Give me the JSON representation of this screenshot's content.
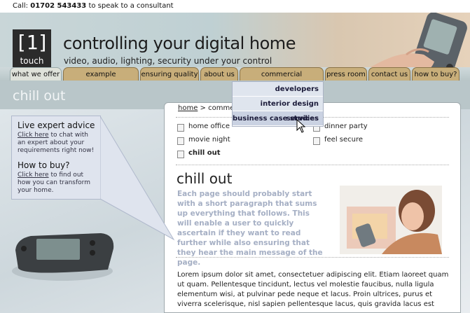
{
  "callbar": {
    "prefix": "Call:",
    "phone": "01702 543433",
    "suffix": "to speak to a consultant"
  },
  "header": {
    "logo_num": "[1]",
    "logo_word": "touch",
    "tagline": "controlling your digital home",
    "subline": "video, audio, lighting, security under your control"
  },
  "tabs": [
    {
      "label": "what we offer"
    },
    {
      "label": "example installations"
    },
    {
      "label": "ensuring quality"
    },
    {
      "label": "about us"
    },
    {
      "label": "commercial partnership"
    },
    {
      "label": "press room"
    },
    {
      "label": "contact us"
    },
    {
      "label": "how to buy?"
    }
  ],
  "dropdown": [
    {
      "label": "developers"
    },
    {
      "label": "interior design services"
    },
    {
      "label": "business case studies"
    }
  ],
  "page_heading": "chill out",
  "callout": {
    "title1": "Live expert advice",
    "link1": "Click here",
    "text1": "to chat with an expert about your requirements right now!",
    "title2": "How to buy?",
    "link2": "Click here",
    "text2": "to find out how you can transform your home."
  },
  "breadcrumb": {
    "home": "home",
    "sep": ">",
    "current": "comme"
  },
  "subnav": [
    {
      "label": "home office"
    },
    {
      "label": "dinner party"
    },
    {
      "label": "movie night"
    },
    {
      "label": "feel secure"
    },
    {
      "label": "chill out"
    }
  ],
  "content": {
    "title": "chill out",
    "intro": "Each page should probably start with a short paragraph that sums up everything that follows. This will enable a user to quickly ascertain if they want to read further while also ensuring that they hear the main message of the page.",
    "body": "Lorem ipsum dolor sit amet, consectetuer adipiscing elit. Etiam laoreet quam ut quam. Pellentesque tincidunt, lectus vel molestie faucibus, nulla ligula elementum wisi, at pulvinar pede neque et lacus. Proin ultrices, purus et viverra scelerisque, nisl sapien pellentesque lacus, quis gravida lacus est"
  },
  "colors": {
    "tab": "#c8ae7a",
    "active_tab": "#dfe2da",
    "dropdown": "#dfe5ee",
    "intro_text": "#a5afc4"
  }
}
